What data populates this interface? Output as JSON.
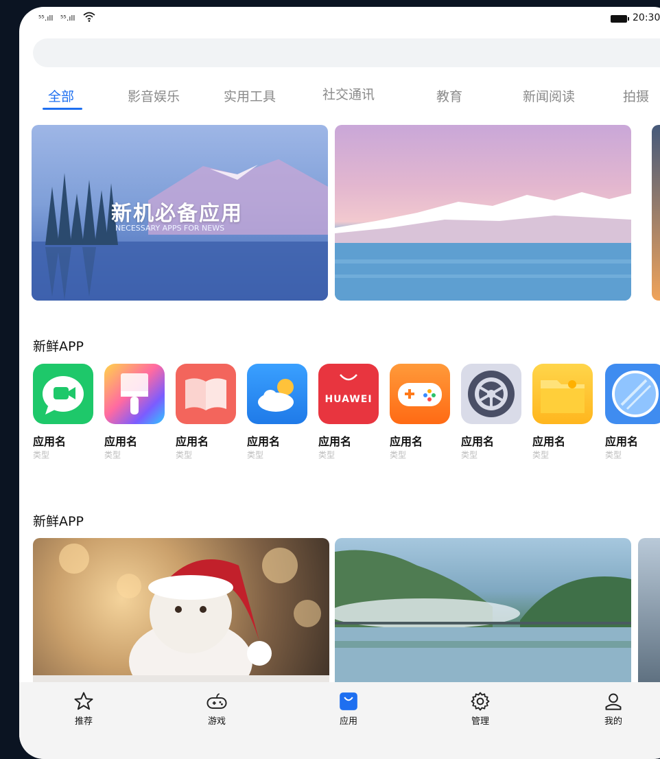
{
  "status_bar": {
    "signal1": "⁵⁵.ıll",
    "signal2": "⁵⁵.ıll",
    "wifi": "wifi-icon",
    "time": "20:30"
  },
  "tabs": [
    {
      "label": "全部",
      "active": true
    },
    {
      "label": "影音娱乐"
    },
    {
      "label": "实用工具"
    },
    {
      "label": "社交通讯"
    },
    {
      "label": "教育"
    },
    {
      "label": "新闻阅读"
    },
    {
      "label": "拍摄"
    }
  ],
  "banner": {
    "title": "新机必备应用",
    "subtitle": "NECESSARY APPS FOR NEWS"
  },
  "sections": {
    "first": "新鲜APP",
    "second": "新鲜APP"
  },
  "apps": [
    {
      "name": "应用名",
      "type": "类型",
      "icon": "message-video-icon",
      "color": "#1ec86a"
    },
    {
      "name": "应用名",
      "type": "类型",
      "icon": "paint-brush-icon",
      "color": "#ff6aa1"
    },
    {
      "name": "应用名",
      "type": "类型",
      "icon": "book-icon",
      "color": "#f3655c"
    },
    {
      "name": "应用名",
      "type": "类型",
      "icon": "weather-icon",
      "color": "#2e8ff5"
    },
    {
      "name": "应用名",
      "type": "类型",
      "icon": "huawei-appgallery-icon",
      "brand": "HUAWEI",
      "color": "#e8353f"
    },
    {
      "name": "应用名",
      "type": "类型",
      "icon": "gamepad-icon",
      "color": "#ff7a1a"
    },
    {
      "name": "应用名",
      "type": "类型",
      "icon": "settings-gear-icon",
      "color": "#4a4f66"
    },
    {
      "name": "应用名",
      "type": "类型",
      "icon": "folder-icon",
      "color": "#ffc83a"
    },
    {
      "name": "应用名",
      "type": "类型",
      "icon": "mirror-icon",
      "color": "#3f8cf0"
    }
  ],
  "bottom_nav": [
    {
      "label": "推荐",
      "icon": "star-icon"
    },
    {
      "label": "游戏",
      "icon": "gamepad-icon"
    },
    {
      "label": "应用",
      "icon": "app-store-bag-icon",
      "active": true
    },
    {
      "label": "管理",
      "icon": "gear-icon"
    },
    {
      "label": "我的",
      "icon": "user-icon"
    }
  ],
  "colors": {
    "accent": "#1e6ff0",
    "tab_inactive": "#8a8a8a",
    "nav_bg": "#f4f4f4"
  }
}
